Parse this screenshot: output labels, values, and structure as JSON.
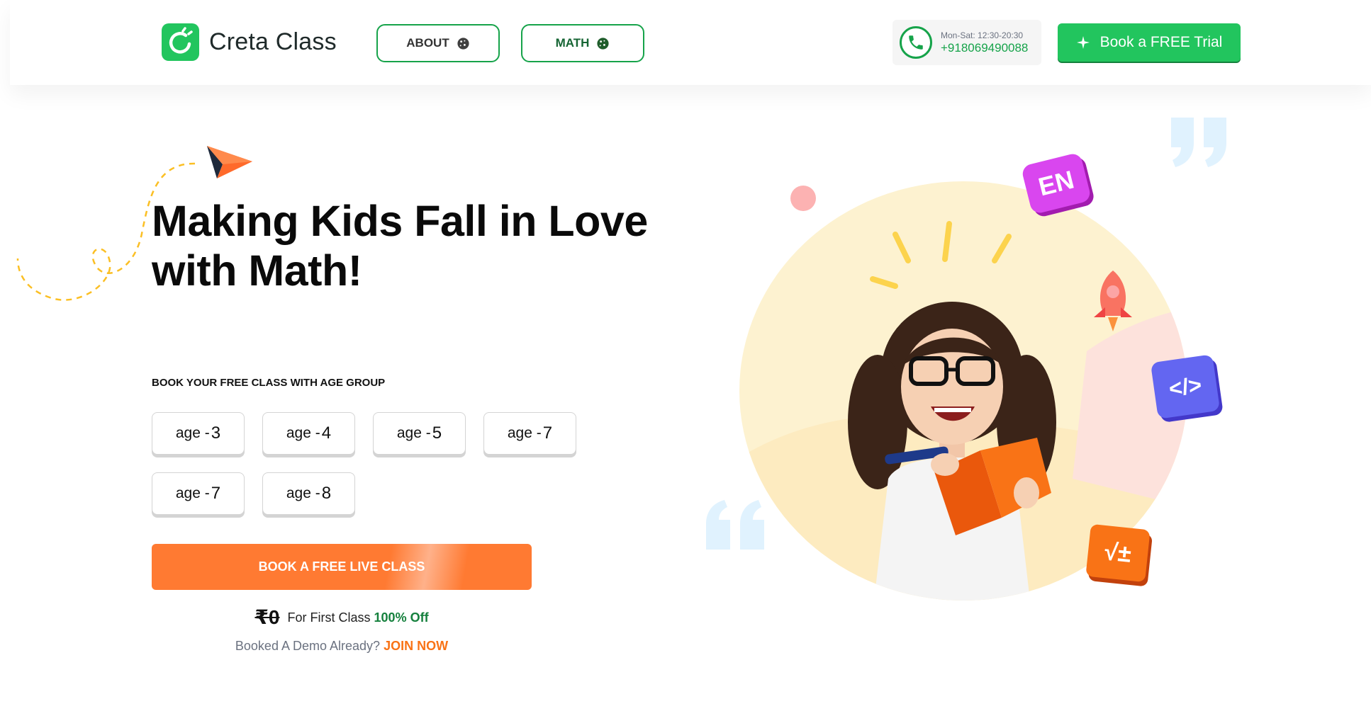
{
  "header": {
    "logo_text": "Creta Class",
    "nav": [
      {
        "label": "ABOUT"
      },
      {
        "label": "MATH"
      }
    ],
    "phone": {
      "hours": "Mon-Sat: 12:30-20:30",
      "number": "+918069490088"
    },
    "trial_button": "Book a FREE Trial"
  },
  "hero": {
    "title_line1": "Making Kids Fall in Love",
    "title_line2": "with Math!",
    "age_label": "BOOK YOUR FREE CLASS WITH AGE GROUP",
    "age_prefix": "age - ",
    "ages": [
      "3",
      "4",
      "5",
      "7",
      "7",
      "8"
    ],
    "cta_button": "BOOK A FREE LIVE CLASS",
    "price_old": "₹0",
    "price_text": "For First Class",
    "price_off": "100% Off",
    "demo_text": "Booked A Demo Already?",
    "join_link": "JOIN NOW"
  },
  "illustration": {
    "badge_en": "EN",
    "badge_code": "</>",
    "badge_math": "√±"
  },
  "colors": {
    "brand_green": "#22c55e",
    "dark_green": "#16a34a",
    "cta_orange": "#ff7a32",
    "join_orange": "#f97316"
  }
}
